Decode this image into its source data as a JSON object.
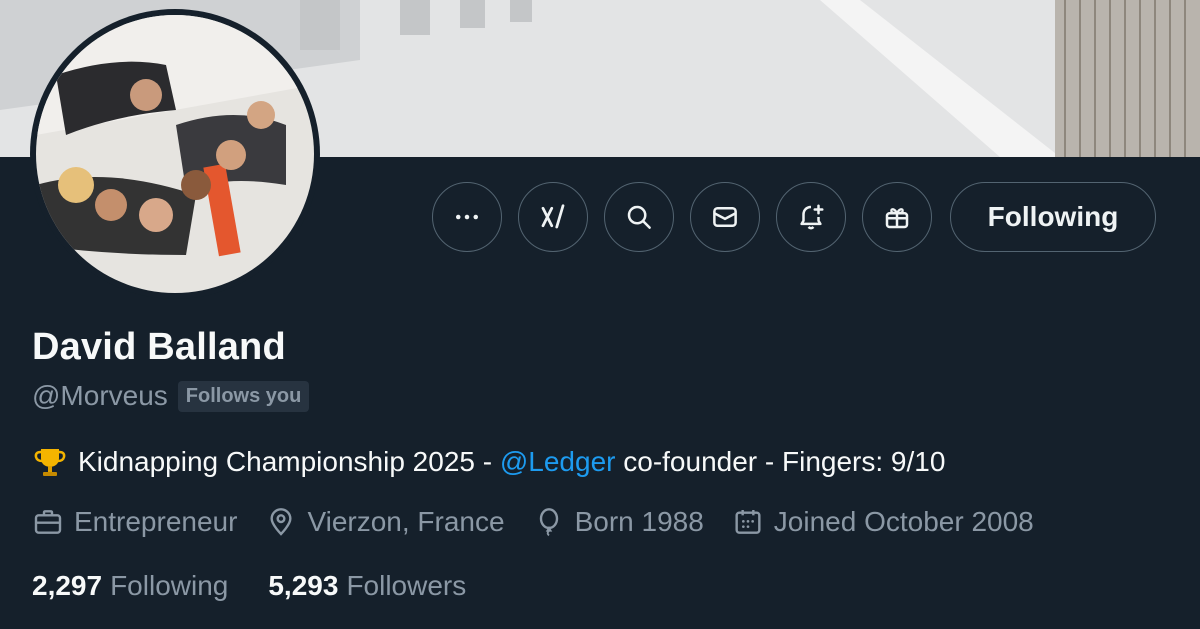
{
  "profile": {
    "name": "David Balland",
    "handle": "@Morveus",
    "follows_you": "Follows you",
    "bio": {
      "prefix": "Kidnapping Championship 2025 - ",
      "mention": "@Ledger",
      "suffix": " co-founder - Fingers: 9/10"
    },
    "meta": {
      "occupation": "Entrepreneur",
      "location": "Vierzon, France",
      "born": "Born 1988",
      "joined": "Joined October 2008"
    },
    "stats": {
      "following_count": "2,297",
      "following_label": "Following",
      "followers_count": "5,293",
      "followers_label": "Followers"
    }
  },
  "actions": {
    "follow_label": "Following",
    "icons": [
      "more-icon",
      "grok-icon",
      "search-icon",
      "message-icon",
      "notification-bell-icon",
      "gift-icon"
    ]
  },
  "colors": {
    "background": "#15202b",
    "accent_link": "#1d9bf0",
    "muted_text": "#8b98a5",
    "border": "#536471"
  }
}
